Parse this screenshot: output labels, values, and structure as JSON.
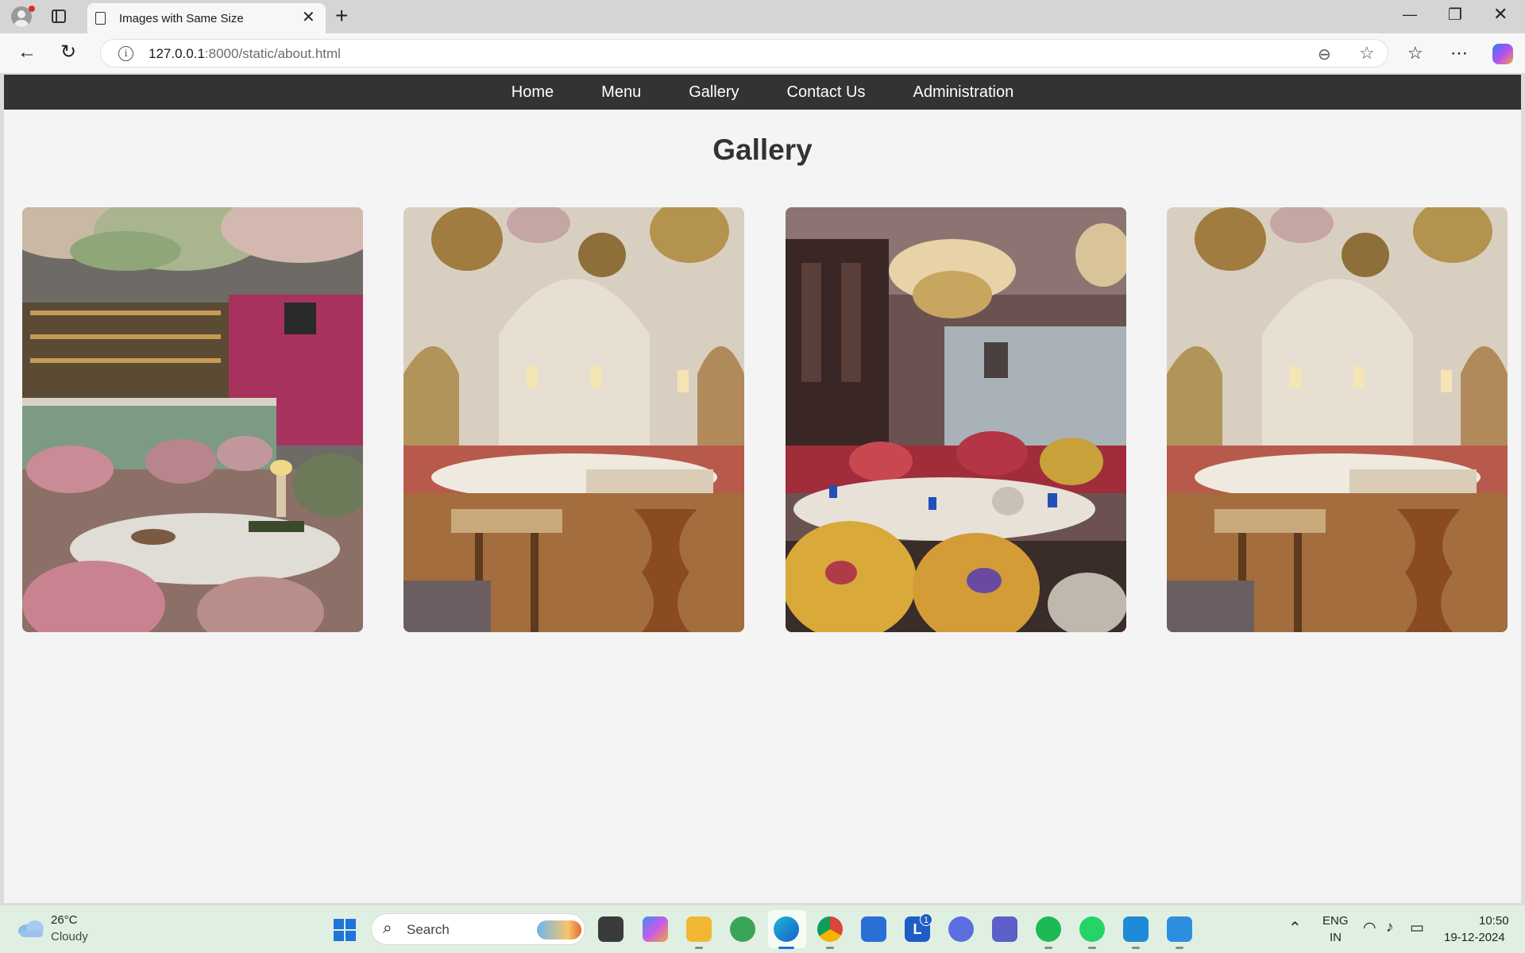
{
  "browser": {
    "tab_title": "Images with Same Size",
    "url_host": "127.0.0.1",
    "url_path": ":8000/static/about.html"
  },
  "site": {
    "nav": [
      "Home",
      "Menu",
      "Gallery",
      "Contact Us",
      "Administration"
    ],
    "page_title": "Gallery",
    "photos": [
      "pink-velvet-bar-dining-room",
      "arched-cream-dining-hall",
      "chandelier-floral-chair-room",
      "arched-cream-dining-hall"
    ]
  },
  "taskbar": {
    "weather_temp": "26°C",
    "weather_condition": "Cloudy",
    "search_placeholder": "Search",
    "notification_badge": "1",
    "language_line1": "ENG",
    "language_line2": "IN",
    "time": "10:50",
    "date": "19-12-2024"
  },
  "colors": {
    "nav_bar": "#333333",
    "page_background": "#f4f4f4",
    "taskbar": "#dff0e2"
  }
}
